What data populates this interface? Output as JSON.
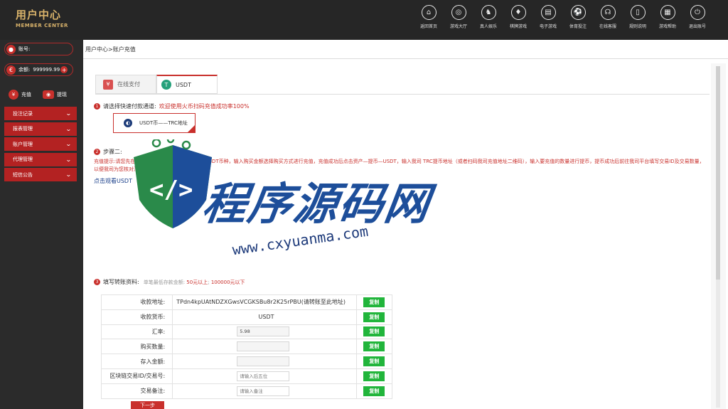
{
  "logo": {
    "cn": "用户中心",
    "en": "MEMBER CENTER"
  },
  "nav": [
    {
      "label": "返回首页",
      "glyph": "⌂"
    },
    {
      "label": "游戏大厅",
      "glyph": "◎"
    },
    {
      "label": "真人娱乐",
      "glyph": "♞"
    },
    {
      "label": "棋牌游戏",
      "glyph": "♦"
    },
    {
      "label": "电子游戏",
      "glyph": "▤"
    },
    {
      "label": "体育投注",
      "glyph": "⚽"
    },
    {
      "label": "在线客服",
      "glyph": "☊"
    },
    {
      "label": "规则说明",
      "glyph": "▯"
    },
    {
      "label": "游戏帮助",
      "glyph": "▦"
    },
    {
      "label": "退出账号",
      "glyph": "⏻"
    }
  ],
  "sidebar": {
    "account_label": "账号:",
    "account_value": "",
    "balance_label": "余额:",
    "balance_value": "999999.99",
    "recharge": "充值",
    "withdraw": "提现",
    "menu": [
      "投注记录",
      "报表管理",
      "账户管理",
      "代理管理",
      "短信公告"
    ]
  },
  "breadcrumb": "用户中心>账户充值",
  "tabs": {
    "online_pay": "在线支付",
    "usdt": "USDT"
  },
  "step1": {
    "title": "请选择快速付款通道:",
    "note": "欢迎使用火币扫码充值成功率100%"
  },
  "channel": {
    "label": "USDT币——TRC地址"
  },
  "step2": {
    "title": "步骤二:"
  },
  "tip": "充值提示:请您先在交易所购买或兑换泰达币，点击USDT币种，输入购买金额选择购买方式进行充值，充值成功后点击资产—提币—USDT，输入我司 TRC提币地址（或者扫码我司充值地址二维码），输入要充值的数量进行提币，提币成功后前往我司平台填写交易ID及交易数量，以便我司为您核对清款请联系在线客服。",
  "watch_link": "点击观看USDT",
  "watermark": {
    "text": "程序源码网",
    "url": "www.cxyuanma.com"
  },
  "step3": {
    "title": "填写转账资料:",
    "note_prefix": "单笔最低存款金额: ",
    "min": "50元以上",
    "sep": "; ",
    "max": "100000元以下"
  },
  "form": {
    "rows": [
      {
        "label": "收款地址:",
        "value": "TPdn4kpUAtNDZXGwsVCGKSBu8r2K25rPBU(请转账至此地址)"
      },
      {
        "label": "收款货币:",
        "value": "USDT"
      },
      {
        "label": "汇率:",
        "value": "5.98"
      },
      {
        "label": "购买数量:",
        "value": ""
      },
      {
        "label": "存入金额:",
        "value": ""
      },
      {
        "label": "区块链交易ID/交易号:",
        "placeholder": "请输入后五位"
      },
      {
        "label": "交易备注:",
        "placeholder": "请输入备注"
      }
    ],
    "copy_label": "复制",
    "next_label": "下一步"
  },
  "colors": {
    "accent_red": "#c9302c",
    "copy_green": "#21b53b",
    "gold": "#d8b26a",
    "usdt_green": "#26a17b"
  }
}
